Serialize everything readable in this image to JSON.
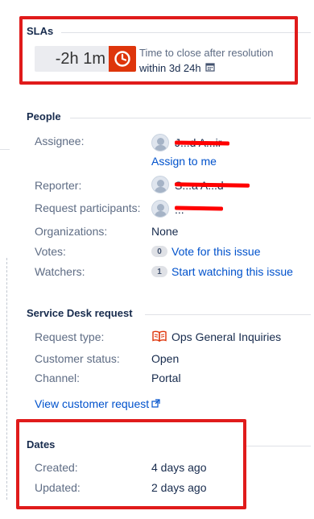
{
  "sla": {
    "title": "SLAs",
    "timer": "-2h 1m",
    "description": "Time to close after resolution",
    "target": "within 3d 24h",
    "icons": [
      "clock-icon",
      "calendar-icon"
    ]
  },
  "people": {
    "title": "People",
    "assignee": {
      "label": "Assignee:",
      "name": "J...d A...ir",
      "assign_to_me": "Assign to me"
    },
    "reporter": {
      "label": "Reporter:",
      "name": "S...a A...d"
    },
    "participants": {
      "label": "Request participants:",
      "name": "..."
    },
    "organizations": {
      "label": "Organizations:",
      "value": "None"
    },
    "votes": {
      "label": "Votes:",
      "count": "0",
      "action": "Vote for this issue"
    },
    "watchers": {
      "label": "Watchers:",
      "count": "1",
      "action": "Start watching this issue"
    }
  },
  "service_desk": {
    "title": "Service Desk request",
    "request_type": {
      "label": "Request type:",
      "value": "Ops General Inquiries",
      "icon": "book-icon"
    },
    "customer_status": {
      "label": "Customer status:",
      "value": "Open"
    },
    "channel": {
      "label": "Channel:",
      "value": "Portal"
    },
    "view_link": "View customer request"
  },
  "dates": {
    "title": "Dates",
    "created": {
      "label": "Created:",
      "value": "4 days ago"
    },
    "updated": {
      "label": "Updated:",
      "value": "2 days ago"
    }
  },
  "colors": {
    "annotation_red": "#e01b1b",
    "sla_clock_bg": "#de350b",
    "link": "#0052cc",
    "text": "#172b4d",
    "muted": "#5e6c84"
  }
}
